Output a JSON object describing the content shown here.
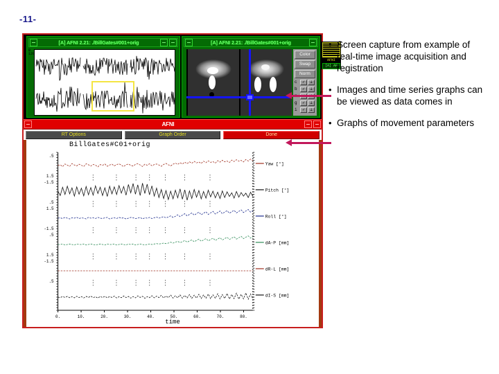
{
  "slide": {
    "number": "-11-"
  },
  "bullets": [
    {
      "marker": "•",
      "text": "Screen capture from example of real-time image acquisition and registration"
    },
    {
      "marker": "•",
      "text": "Images and time series graphs can be viewed as data comes in"
    },
    {
      "marker": "•",
      "text": "Graphs of movement parameters"
    }
  ],
  "screenshot": {
    "windows": {
      "timeseries": {
        "title": "[A] AFNI 2.21: ./BillGates#001+orig",
        "y_axis_label": "0\n1200"
      },
      "images": {
        "title": "[A] AFNI 2.21: ./BillGates#001+orig"
      }
    },
    "image_controls": {
      "buttons": [
        "Color",
        "Swap",
        "Norm"
      ],
      "toggles": [
        {
          "label": "c",
          "box1": "✓",
          "box2": "⊥"
        },
        {
          "label": "b",
          "box1": "✓",
          "box2": "⊥"
        },
        {
          "label": "n",
          "box1": "✓",
          "box2": "⊥"
        },
        {
          "label": "g",
          "box1": "✓",
          "box2": "⊥"
        },
        {
          "label": "i",
          "box1": "✓",
          "box2": "⊥"
        }
      ]
    },
    "app_icon": {
      "caption": "AFNI",
      "caption2": "[A] AF"
    },
    "afni_window": {
      "title": "AFNI",
      "buttons": [
        {
          "label": "RT Options",
          "style": "normal"
        },
        {
          "label": "Graph Order",
          "style": "normal"
        },
        {
          "label": "Done",
          "style": "danger"
        }
      ]
    }
  },
  "chart_data": {
    "type": "line",
    "title": "BillGates#C01+orig",
    "xlabel": "time",
    "ylabel": "",
    "xlim": [
      0,
      84
    ],
    "xticks": [
      0,
      10,
      20,
      30,
      40,
      50,
      60,
      70,
      80
    ],
    "xticklabels": [
      "0.",
      "10.",
      "20.",
      "30.",
      "40.",
      "50.",
      "60.",
      "70.",
      "80."
    ],
    "grid": false,
    "legend_position": "right",
    "panel_yticklabels": [
      ".5",
      "1.5",
      "-1.5",
      ".5",
      "1.5",
      "-1.5",
      ".5",
      "1.5",
      "-1.5"
    ],
    "series": [
      {
        "name": "Yaw [°]",
        "color": "#a03020",
        "ylim": [
          -0.06,
          0.06
        ],
        "values": [
          0.0,
          0.004,
          -0.006,
          0.008,
          0.002,
          -0.004,
          0.01,
          0.003,
          -0.002,
          0.007,
          0.001,
          -0.005,
          0.009,
          0.004,
          -0.003,
          0.006,
          0.002,
          -0.007,
          0.005,
          0.001,
          0.008,
          -0.004,
          0.003,
          0.007,
          -0.002,
          0.005,
          0.009,
          0.002,
          -0.006,
          0.004,
          0.008,
          0.001,
          -0.003,
          0.006,
          0.01,
          0.003,
          -0.005,
          0.007,
          0.002,
          0.009,
          -0.001,
          0.005,
          0.008,
          0.003,
          -0.004,
          0.006,
          0.011,
          0.004,
          -0.002,
          0.007,
          0.013,
          0.006,
          0.015,
          0.008,
          0.018,
          0.01,
          0.02,
          0.012,
          0.022,
          0.014,
          0.019,
          0.011,
          0.023,
          0.015,
          0.025,
          0.017,
          0.021,
          0.013,
          0.026,
          0.018,
          0.028,
          0.02,
          0.024,
          0.016,
          0.029,
          0.021,
          0.031,
          0.023,
          0.027,
          0.019,
          0.032,
          0.024,
          0.034,
          0.026
        ]
      },
      {
        "name": "Pitch [°]",
        "color": "#101010",
        "ylim": [
          -1.7,
          1.7
        ],
        "values": [
          0.1,
          -0.55,
          0.7,
          -0.4,
          0.85,
          -0.3,
          0.6,
          -0.65,
          0.75,
          -0.35,
          0.55,
          -0.6,
          0.8,
          -0.45,
          0.65,
          -0.5,
          0.9,
          -0.25,
          0.7,
          -0.55,
          0.6,
          -0.7,
          0.85,
          -0.3,
          0.75,
          -0.4,
          0.95,
          -0.2,
          0.8,
          -0.5,
          1.1,
          -0.15,
          1.25,
          -0.35,
          1.05,
          -0.55,
          1.3,
          -0.25,
          1.15,
          -0.45,
          0.9,
          -0.65,
          0.55,
          -0.85,
          0.35,
          -1.0,
          0.2,
          -1.15,
          0.1,
          -1.05,
          0.25,
          -0.9,
          0.45,
          -1.1,
          0.3,
          -1.25,
          0.15,
          -1.0,
          0.35,
          -0.8,
          0.2,
          -1.05,
          0.05,
          -0.95,
          0.25,
          -0.75,
          0.1,
          -0.9,
          -0.05,
          -1.0,
          0.15,
          -0.85,
          0.0,
          -0.7,
          -0.15,
          -0.95,
          0.05,
          -0.8,
          -0.1,
          -0.65,
          -0.2,
          -0.85,
          -0.05,
          -0.7
        ]
      },
      {
        "name": "Roll [°]",
        "color": "#1a2a8c",
        "ylim": [
          -0.3,
          0.3
        ],
        "values": [
          0.0,
          0.01,
          -0.01,
          0.02,
          0.0,
          -0.02,
          0.01,
          0.0,
          0.02,
          -0.01,
          0.01,
          0.0,
          -0.02,
          0.02,
          0.0,
          0.01,
          -0.01,
          0.02,
          0.0,
          -0.01,
          0.01,
          0.02,
          -0.02,
          0.0,
          0.01,
          -0.01,
          0.02,
          0.0,
          0.01,
          -0.02,
          0.0,
          0.02,
          0.01,
          -0.01,
          0.0,
          0.02,
          -0.02,
          0.01,
          0.0,
          0.02,
          -0.01,
          0.01,
          0.03,
          0.0,
          0.02,
          0.04,
          0.01,
          0.03,
          0.06,
          0.02,
          0.05,
          0.09,
          0.04,
          0.08,
          0.12,
          0.06,
          0.1,
          0.14,
          0.08,
          0.12,
          0.16,
          0.09,
          0.13,
          0.17,
          0.1,
          0.14,
          0.18,
          0.11,
          0.15,
          0.19,
          0.12,
          0.16,
          0.2,
          0.13,
          0.17,
          0.21,
          0.14,
          0.18,
          0.22,
          0.15,
          0.19,
          0.23,
          0.16,
          0.2
        ]
      },
      {
        "name": "dA-P [mm]",
        "color": "#2e8b57",
        "ylim": [
          -0.25,
          0.25
        ],
        "values": [
          0.0,
          0.0,
          0.01,
          -0.01,
          0.0,
          0.01,
          0.0,
          -0.01,
          0.01,
          0.0,
          0.0,
          0.01,
          -0.01,
          0.0,
          0.01,
          0.0,
          -0.01,
          0.0,
          0.01,
          0.0,
          -0.01,
          0.01,
          0.0,
          0.0,
          0.01,
          -0.01,
          0.0,
          0.01,
          0.0,
          -0.01,
          0.01,
          0.0,
          0.01,
          -0.01,
          0.0,
          0.01,
          0.0,
          -0.01,
          0.0,
          0.01,
          0.0,
          0.01,
          0.02,
          0.01,
          0.02,
          0.03,
          0.02,
          0.03,
          0.05,
          0.03,
          0.05,
          0.07,
          0.04,
          0.06,
          0.09,
          0.05,
          0.08,
          0.1,
          0.06,
          0.09,
          0.12,
          0.07,
          0.1,
          0.13,
          0.08,
          0.11,
          0.14,
          0.09,
          0.12,
          0.15,
          0.1,
          0.13,
          0.16,
          0.11,
          0.14,
          0.17,
          0.12,
          0.15,
          0.18,
          0.13,
          0.16,
          0.19,
          0.14,
          0.17
        ]
      },
      {
        "name": "dR-L [mm]",
        "color": "#a03020",
        "ylim": [
          -0.25,
          0.25
        ],
        "values": [
          0.0,
          0.0,
          0.0,
          0.0,
          0.0,
          0.0,
          0.0,
          0.0,
          0.0,
          0.0,
          0.0,
          0.0,
          0.0,
          0.0,
          0.0,
          0.0,
          0.0,
          0.0,
          0.0,
          0.0,
          0.0,
          0.0,
          0.0,
          0.0,
          0.0,
          0.0,
          0.0,
          0.0,
          0.0,
          0.0,
          0.0,
          0.0,
          0.0,
          0.0,
          0.0,
          0.0,
          0.0,
          0.0,
          0.0,
          0.0,
          0.0,
          0.0,
          0.0,
          0.0,
          0.0,
          0.0,
          0.0,
          0.0,
          0.0,
          0.0,
          0.0,
          0.0,
          0.0,
          0.0,
          0.0,
          0.0,
          0.0,
          0.0,
          0.0,
          0.0,
          0.0,
          0.0,
          0.0,
          0.0,
          0.0,
          0.0,
          0.0,
          0.0,
          0.0,
          0.0,
          0.0,
          0.0,
          0.0,
          0.0,
          0.0,
          0.0,
          0.0,
          0.0,
          0.0,
          0.0,
          0.0,
          0.0,
          0.0,
          0.0
        ]
      },
      {
        "name": "dI-S [mm]",
        "color": "#101010",
        "ylim": [
          -0.8,
          0.8
        ],
        "values": [
          0.0,
          -0.03,
          0.04,
          -0.02,
          0.05,
          -0.04,
          0.03,
          -0.05,
          0.06,
          -0.03,
          0.04,
          -0.06,
          0.05,
          -0.02,
          0.07,
          -0.04,
          0.03,
          -0.07,
          0.05,
          -0.03,
          0.06,
          -0.05,
          0.04,
          -0.02,
          0.07,
          -0.06,
          0.03,
          -0.04,
          0.08,
          -0.03,
          0.05,
          -0.07,
          0.04,
          -0.05,
          0.09,
          -0.02,
          0.06,
          -0.08,
          0.03,
          -0.04,
          0.1,
          -0.05,
          0.07,
          -0.03,
          0.12,
          -0.06,
          0.08,
          -0.04,
          0.14,
          -0.07,
          0.1,
          -0.05,
          0.16,
          -0.08,
          0.12,
          -0.06,
          0.18,
          -0.09,
          0.14,
          -0.07,
          0.2,
          -0.1,
          0.15,
          -0.08,
          0.22,
          -0.11,
          0.16,
          -0.09,
          0.24,
          -0.12,
          0.18,
          -0.1,
          0.26,
          -0.13,
          0.19,
          -0.11,
          0.28,
          -0.14,
          0.2,
          -0.12,
          0.3,
          -0.15,
          0.22,
          -0.13
        ]
      }
    ]
  }
}
